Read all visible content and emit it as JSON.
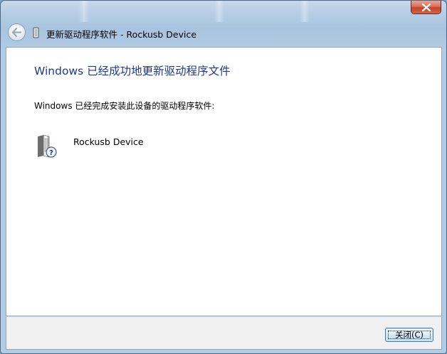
{
  "window": {
    "nav_title": "更新驱动程序软件 - Rockusb Device"
  },
  "content": {
    "heading": "Windows 已经成功地更新驱动程序文件",
    "status": "Windows 已经完成安装此设备的驱动程序软件:",
    "device_name": "Rockusb Device"
  },
  "buttons": {
    "close_label": "关闭(C)"
  },
  "icons": {
    "window_close": "close-icon",
    "back": "back-arrow-icon",
    "nav_device": "usb-device-icon",
    "device": "unknown-device-icon"
  },
  "colors": {
    "heading": "#1e3a8c",
    "close_button_red": "#c4432b",
    "button_border": "#3c7fb1"
  }
}
